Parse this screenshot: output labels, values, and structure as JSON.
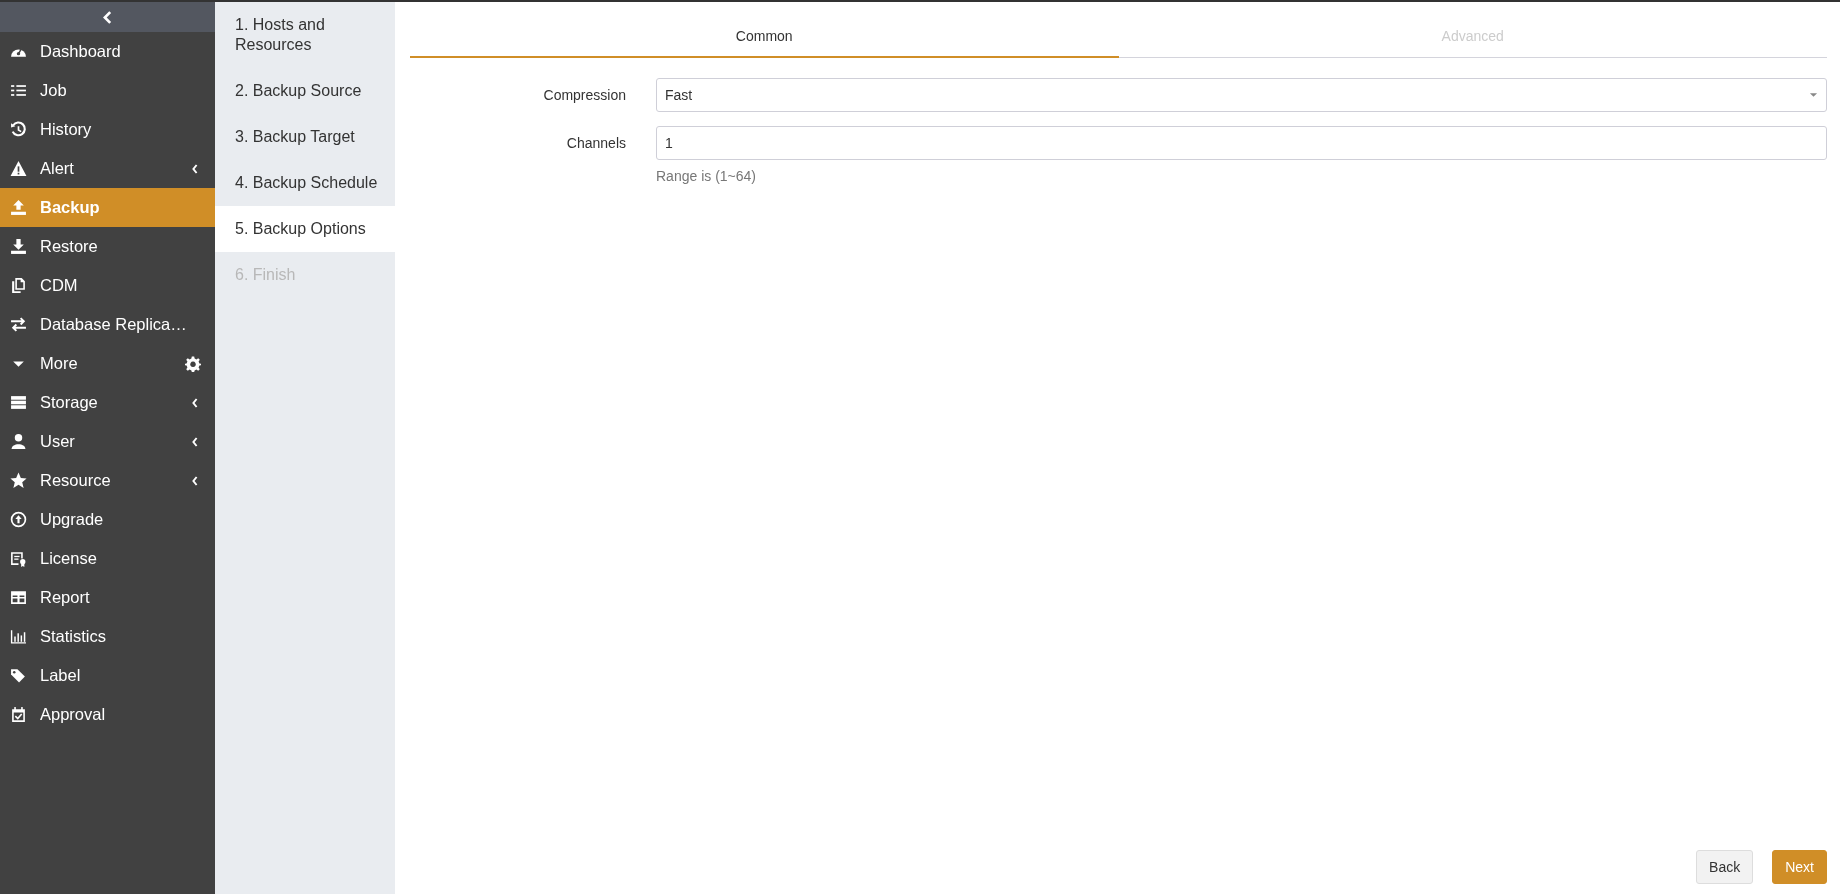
{
  "sidebar": {
    "items": [
      {
        "label": "Dashboard",
        "kind": "link",
        "selected": false
      },
      {
        "label": "Job",
        "kind": "link",
        "selected": false
      },
      {
        "label": "History",
        "kind": "link",
        "selected": false
      },
      {
        "label": "Alert",
        "kind": "submenu",
        "selected": false
      },
      {
        "label": "Backup",
        "kind": "link",
        "selected": true
      },
      {
        "label": "Restore",
        "kind": "link",
        "selected": false
      },
      {
        "label": "CDM",
        "kind": "link",
        "selected": false
      },
      {
        "label": "Database Replica…",
        "kind": "link",
        "selected": false
      },
      {
        "label": "More",
        "kind": "settings",
        "selected": false
      },
      {
        "label": "Storage",
        "kind": "submenu",
        "selected": false
      },
      {
        "label": "User",
        "kind": "submenu",
        "selected": false
      },
      {
        "label": "Resource",
        "kind": "submenu",
        "selected": false
      },
      {
        "label": "Upgrade",
        "kind": "link",
        "selected": false
      },
      {
        "label": "License",
        "kind": "link",
        "selected": false
      },
      {
        "label": "Report",
        "kind": "link",
        "selected": false
      },
      {
        "label": "Statistics",
        "kind": "link",
        "selected": false
      },
      {
        "label": "Label",
        "kind": "link",
        "selected": false
      },
      {
        "label": "Approval",
        "kind": "link",
        "selected": false
      }
    ]
  },
  "steps": [
    {
      "label": "1. Hosts and Resources",
      "selected": false,
      "disabled": false
    },
    {
      "label": "2. Backup Source",
      "selected": false,
      "disabled": false
    },
    {
      "label": "3. Backup Target",
      "selected": false,
      "disabled": false
    },
    {
      "label": "4. Backup Schedule",
      "selected": false,
      "disabled": false
    },
    {
      "label": "5. Backup Options",
      "selected": true,
      "disabled": false
    },
    {
      "label": "6. Finish",
      "selected": false,
      "disabled": true
    }
  ],
  "tabs": [
    {
      "label": "Common",
      "selected": true
    },
    {
      "label": "Advanced",
      "selected": false
    }
  ],
  "form": {
    "compression": {
      "label": "Compression",
      "value": "Fast"
    },
    "channels": {
      "label": "Channels",
      "value": "1",
      "hint": "Range is (1~64)"
    }
  },
  "buttons": {
    "back": "Back",
    "next": "Next"
  }
}
